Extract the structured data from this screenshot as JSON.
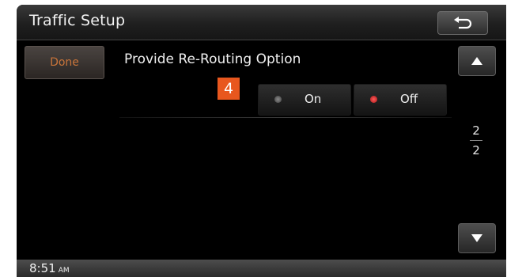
{
  "header": {
    "title": "Traffic Setup",
    "back_icon": "return-arrow-icon"
  },
  "menu": {
    "done_label": "Done",
    "option_label": "Provide Re-Routing Option",
    "callout_number": "4",
    "on_label": "On",
    "off_label": "Off",
    "selected": "Off"
  },
  "scroll": {
    "up_icon": "triangle-up-icon",
    "down_icon": "triangle-down-icon",
    "current_page": "2",
    "total_pages": "2"
  },
  "status": {
    "time": "8:51",
    "ampm": "AM"
  },
  "colors": {
    "accent": "#e8571e",
    "done_text": "#c8743a",
    "off_indicator": "#d62424"
  }
}
